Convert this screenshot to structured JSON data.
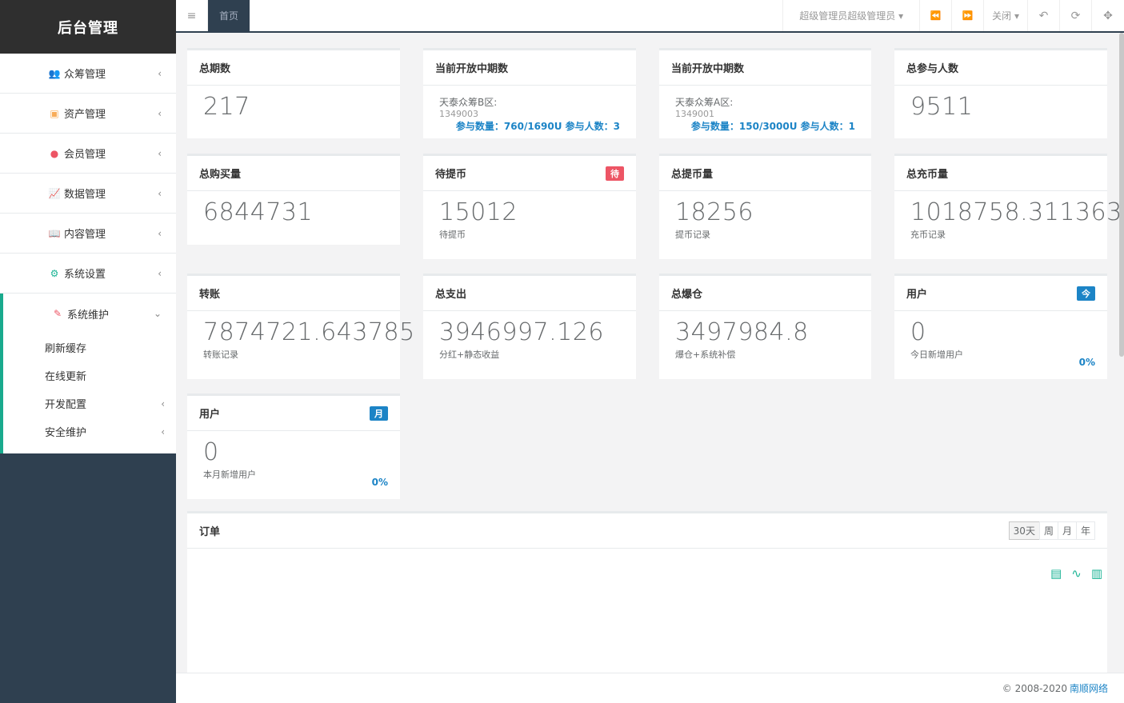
{
  "sidebar": {
    "title": "后台管理",
    "items": [
      {
        "label": "众筹管理",
        "icon": "users-icon",
        "color": "#23c6c8"
      },
      {
        "label": "资产管理",
        "icon": "money-icon",
        "color": "#f8ac59"
      },
      {
        "label": "会员管理",
        "icon": "user-icon",
        "color": "#ed5565"
      },
      {
        "label": "数据管理",
        "icon": "line-chart-icon",
        "color": "#1c84c6"
      },
      {
        "label": "内容管理",
        "icon": "book-icon",
        "color": "#888888"
      },
      {
        "label": "系统设置",
        "icon": "gear-icon",
        "color": "#1ab394"
      },
      {
        "label": "系统维护",
        "icon": "magic-icon",
        "color": "#ed5565"
      }
    ],
    "subitems": [
      {
        "label": "刷新缓存"
      },
      {
        "label": "在线更新"
      },
      {
        "label": "开发配置"
      },
      {
        "label": "安全维护"
      }
    ]
  },
  "topbar": {
    "menu_icon": "≡",
    "active_tab": "首页",
    "user": "超级管理员超级管理员",
    "close_label": "关闭",
    "prev_icon": "⏪",
    "next_icon": "⏩",
    "back_icon": "↶",
    "refresh_icon": "⟳",
    "fullscreen_icon": "✥"
  },
  "cards": {
    "total_periods": {
      "title": "总期数",
      "value": "217"
    },
    "open_b": {
      "title": "当前开放中期数",
      "name": "天泰众筹B区:",
      "no": "1349003",
      "stat": "参与数量：760/1690U 参与人数：3"
    },
    "open_a": {
      "title": "当前开放中期数",
      "name": "天泰众筹A区:",
      "no": "1349001",
      "stat": "参与数量：150/3000U 参与人数：1"
    },
    "total_participants": {
      "title": "总参与人数",
      "value": "9511"
    },
    "total_purchase": {
      "title": "总购买量",
      "value": "6844731"
    },
    "pending_withdraw": {
      "title": "待提币",
      "badge": "待",
      "value": "15012",
      "sub": "待提币"
    },
    "total_withdraw": {
      "title": "总提币量",
      "value": "18256",
      "sub": "提币记录"
    },
    "total_recharge": {
      "title": "总充币量",
      "value": "1018758.311363",
      "sub": "充币记录"
    },
    "transfer": {
      "title": "转账",
      "value": "7874721.643785",
      "sub": "转账记录"
    },
    "total_expense": {
      "title": "总支出",
      "value": "3946997.126",
      "sub": "分红+静态收益"
    },
    "total_liquidation": {
      "title": "总爆仓",
      "value": "3497984.8",
      "sub": "爆仓+系统补偿"
    },
    "users_today": {
      "title": "用户",
      "badge": "今",
      "value": "0",
      "sub": "今日新增用户",
      "pct": "0%"
    },
    "users_month": {
      "title": "用户",
      "badge": "月",
      "value": "0",
      "sub": "本月新增用户",
      "pct": "0%"
    }
  },
  "orders": {
    "title": "订单",
    "ranges": [
      "30天",
      "周",
      "月",
      "年"
    ],
    "active_range": "30天"
  },
  "footer": {
    "copyright": "© 2008-2020",
    "link": "南顺网络"
  }
}
